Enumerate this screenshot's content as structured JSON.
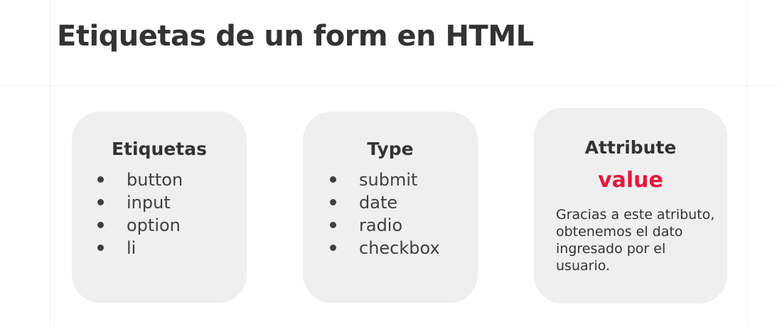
{
  "title": "Etiquetas de un form en HTML",
  "accent_color": "#e8163c",
  "card_color": "#efefef",
  "cards": [
    {
      "heading": "Etiquetas",
      "items": [
        "button",
        "input",
        "option",
        "li"
      ]
    },
    {
      "heading": "Type",
      "items": [
        "submit",
        "date",
        "radio",
        "checkbox"
      ]
    },
    {
      "heading": "Attribute",
      "highlight": "value",
      "description": "Gracias a este atributo, obtenemos el dato ingresado por el usuario."
    }
  ]
}
